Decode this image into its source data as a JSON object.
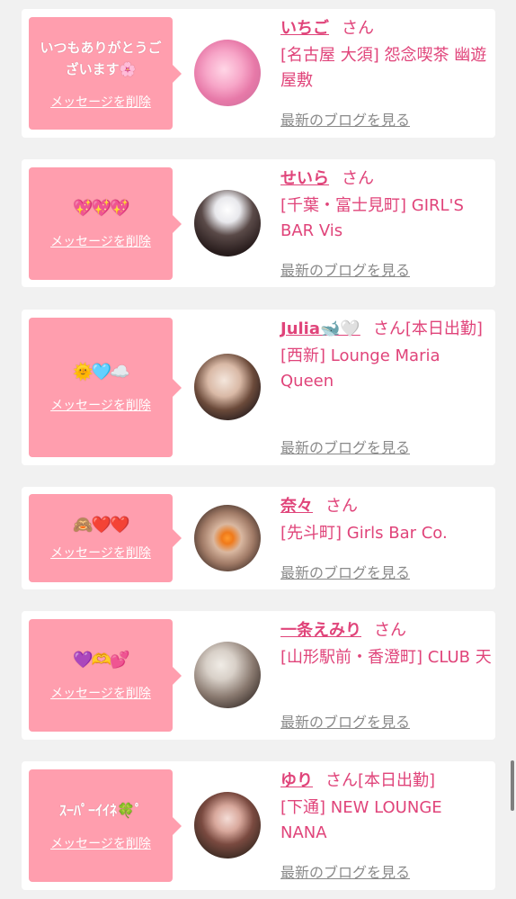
{
  "colors": {
    "accent_pink": "#e0447a",
    "bubble_pink": "#ff9eae",
    "link_gray": "#8a8a8a",
    "background": "#f1f1f1"
  },
  "delete_label": "メッセージを削除",
  "blog_label": "最新のブログを見る",
  "cards": [
    {
      "message": "いつもありがとうございます🌸",
      "name": "いちご",
      "suffix": "さん",
      "shop": "[名古屋 大須] 怨念喫茶 幽遊屋敷"
    },
    {
      "message": "💖💖💖",
      "name": "せいら",
      "suffix": "さん",
      "shop": "[千葉・富士見町] GIRL'S BAR Vis"
    },
    {
      "message": "🌞🩵☁️",
      "name": "Julia🐋🤍",
      "suffix": "さん[本日出勤]",
      "shop": "[西新] Lounge Maria Queen"
    },
    {
      "message": "🙈❤️❤️",
      "name": "奈々",
      "suffix": "さん",
      "shop": "[先斗町] Girls Bar Co."
    },
    {
      "message": "💜🫶💕",
      "name": "一条えみり",
      "suffix": "さん",
      "shop": "[山形駅前・香澄町] CLUB 天"
    },
    {
      "message": "ｽｰﾊﾟｰｲｲﾈ🍀ﾟ",
      "name": "ゆり",
      "suffix": "さん[本日出勤]",
      "shop": "[下通] NEW LOUNGE NANA"
    }
  ]
}
